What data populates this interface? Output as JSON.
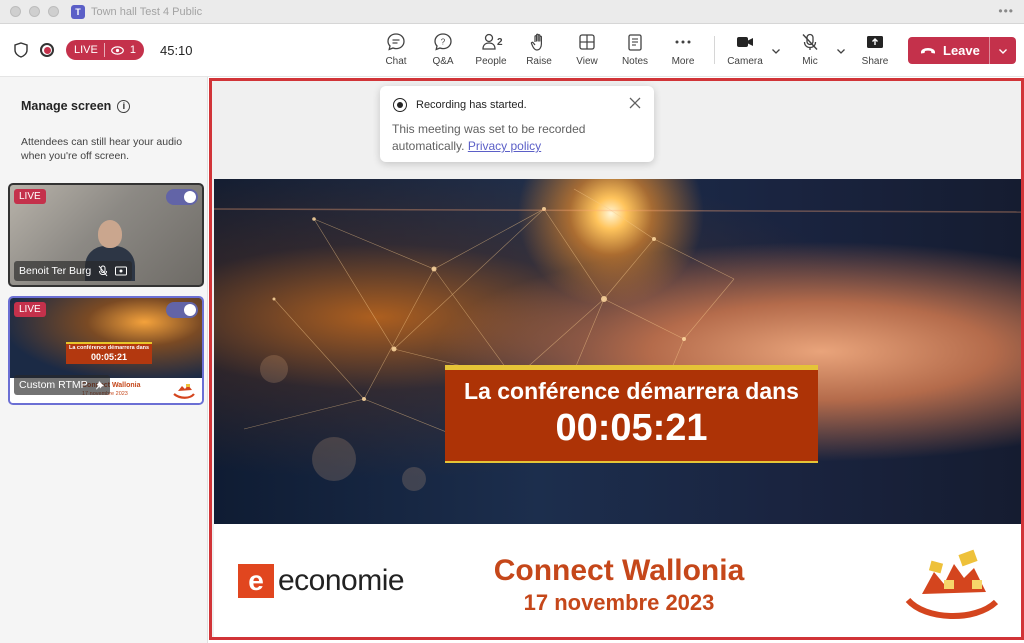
{
  "window": {
    "title": "Town hall Test 4 Public"
  },
  "toolbar": {
    "live_label": "LIVE",
    "viewer_count": "1",
    "timer": "45:10",
    "people_count": "2",
    "buttons": {
      "chat": "Chat",
      "qa": "Q&A",
      "people": "People",
      "raise": "Raise",
      "view": "View",
      "notes": "Notes",
      "more": "More",
      "camera": "Camera",
      "mic": "Mic",
      "share": "Share"
    },
    "leave_label": "Leave"
  },
  "sidebar": {
    "title": "Manage screen",
    "description": "Attendees can still hear your audio when you're off screen.",
    "tiles": [
      {
        "badge": "LIVE",
        "name": "Benoit Ter Burg"
      },
      {
        "badge": "LIVE",
        "name": "Custom RTMP",
        "thumb_banner_top": "La conférence démarrera dans",
        "thumb_banner_time": "00:05:21",
        "thumb_title": "Connect Wallonia",
        "thumb_date": "17 novembre 2023"
      }
    ]
  },
  "notification": {
    "title": "Recording has started.",
    "body": "This meeting was set to be recorded automatically.",
    "link": "Privacy policy"
  },
  "slide": {
    "countdown_label": "La conférence démarrera dans",
    "countdown_time": "00:05:21",
    "logo_text": "economie",
    "event_title": "Connect Wallonia",
    "event_date": "17 novembre 2023"
  },
  "colors": {
    "accent": "#c4314b",
    "brand": "#5b5fc7",
    "slide_orange": "#c5471a"
  }
}
